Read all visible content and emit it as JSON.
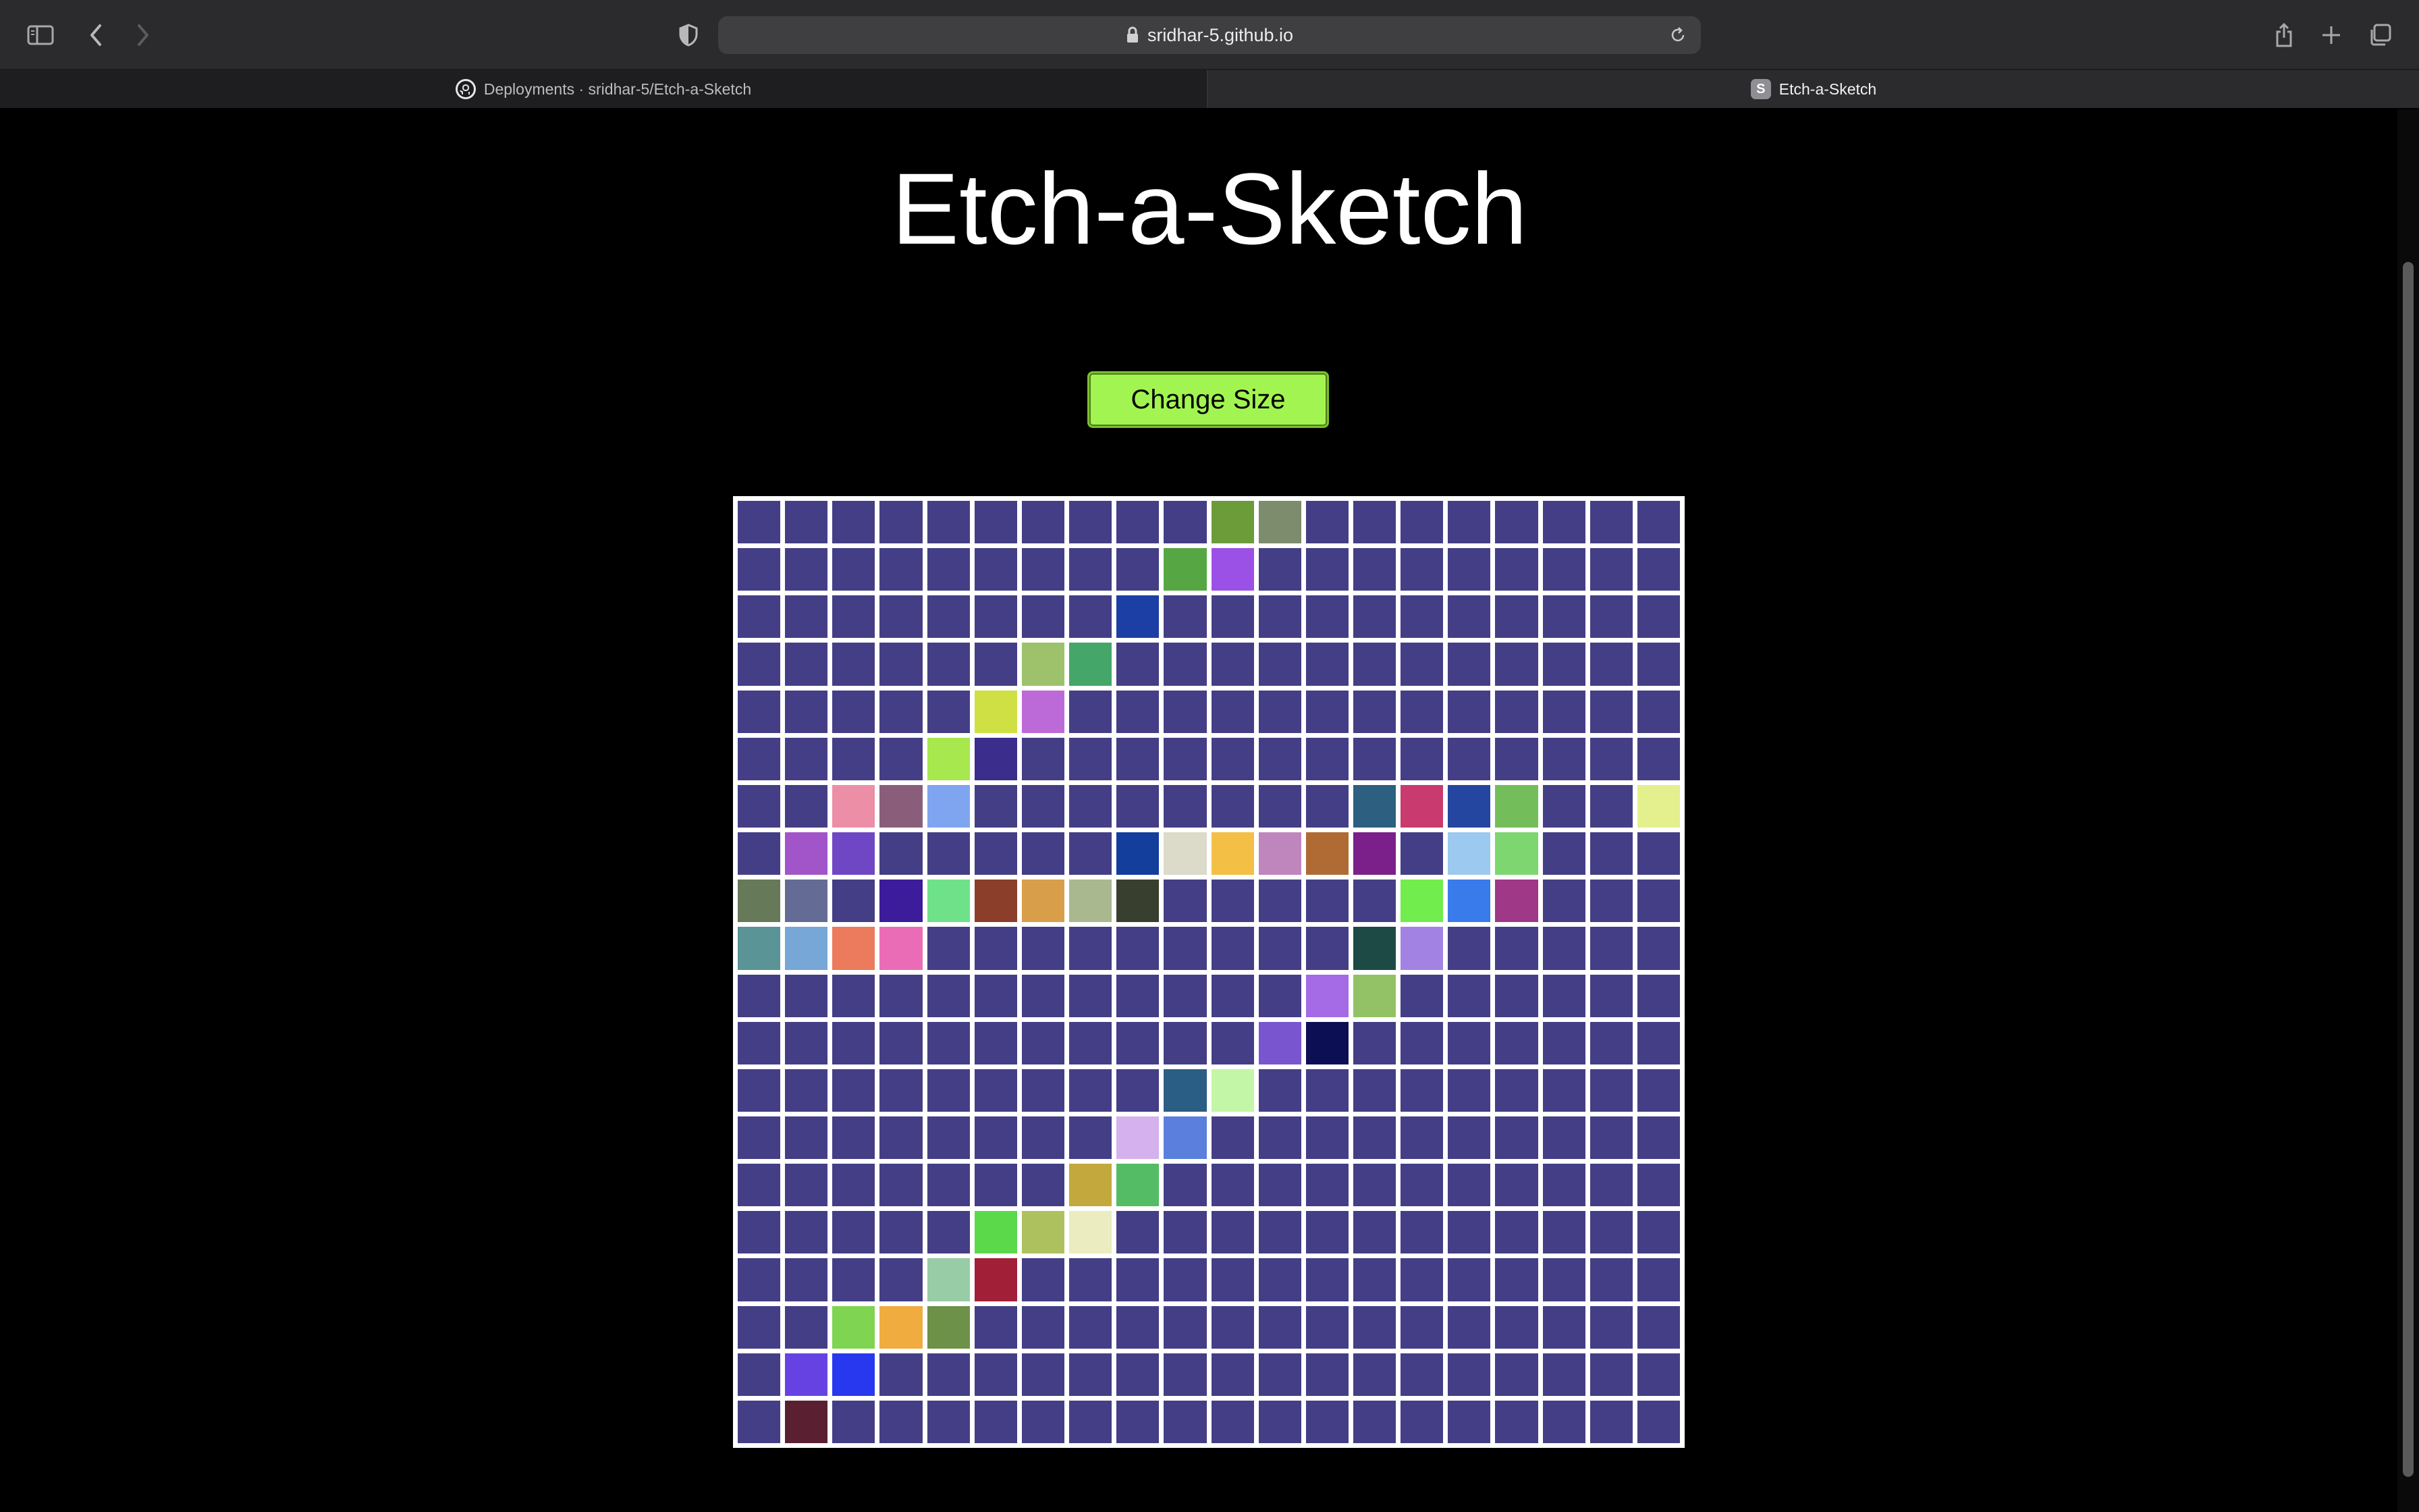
{
  "browser": {
    "url": "sridhar-5.github.io",
    "tabs": [
      {
        "label": "Deployments · sridhar-5/Etch-a-Sketch",
        "icon": "github-icon",
        "active": false
      },
      {
        "label": "Etch-a-Sketch",
        "icon": "S",
        "active": true
      }
    ]
  },
  "page": {
    "title": "Etch-a-Sketch",
    "change_size_label": "Change Size"
  },
  "grid": {
    "size": 20,
    "base_color": "#443e86",
    "colored_cells": [
      {
        "r": 0,
        "c": 10,
        "color": "#6c9b3a"
      },
      {
        "r": 0,
        "c": 11,
        "color": "#7d8c6c"
      },
      {
        "r": 1,
        "c": 9,
        "color": "#56a744"
      },
      {
        "r": 1,
        "c": 10,
        "color": "#9b50e6"
      },
      {
        "r": 2,
        "c": 8,
        "color": "#1b3fa5"
      },
      {
        "r": 3,
        "c": 6,
        "color": "#9dc26b"
      },
      {
        "r": 3,
        "c": 7,
        "color": "#45a66a"
      },
      {
        "r": 4,
        "c": 5,
        "color": "#cfe045"
      },
      {
        "r": 4,
        "c": 6,
        "color": "#bd6ad9"
      },
      {
        "r": 5,
        "c": 4,
        "color": "#a6e84d"
      },
      {
        "r": 5,
        "c": 5,
        "color": "#3a2d8b"
      },
      {
        "r": 6,
        "c": 2,
        "color": "#ec8fa6"
      },
      {
        "r": 6,
        "c": 3,
        "color": "#8a5e7a"
      },
      {
        "r": 6,
        "c": 4,
        "color": "#7fa4f0"
      },
      {
        "r": 6,
        "c": 13,
        "color": "#2c5f80"
      },
      {
        "r": 6,
        "c": 14,
        "color": "#c93a6e"
      },
      {
        "r": 6,
        "c": 15,
        "color": "#2446a0"
      },
      {
        "r": 6,
        "c": 16,
        "color": "#73be5a"
      },
      {
        "r": 6,
        "c": 19,
        "color": "#e4ef8e"
      },
      {
        "r": 7,
        "c": 1,
        "color": "#a254c9"
      },
      {
        "r": 7,
        "c": 2,
        "color": "#6f47c5"
      },
      {
        "r": 7,
        "c": 8,
        "color": "#143e9c"
      },
      {
        "r": 7,
        "c": 9,
        "color": "#dcdac8"
      },
      {
        "r": 7,
        "c": 10,
        "color": "#f3bf45"
      },
      {
        "r": 7,
        "c": 11,
        "color": "#be86bd"
      },
      {
        "r": 7,
        "c": 12,
        "color": "#b06a33"
      },
      {
        "r": 7,
        "c": 13,
        "color": "#7b1f8a"
      },
      {
        "r": 7,
        "c": 15,
        "color": "#9cc9ef"
      },
      {
        "r": 7,
        "c": 16,
        "color": "#7dd670"
      },
      {
        "r": 8,
        "c": 0,
        "color": "#667a5a"
      },
      {
        "r": 8,
        "c": 1,
        "color": "#646b94"
      },
      {
        "r": 8,
        "c": 3,
        "color": "#3c1c9a"
      },
      {
        "r": 8,
        "c": 4,
        "color": "#6fe189"
      },
      {
        "r": 8,
        "c": 5,
        "color": "#8b3e2a"
      },
      {
        "r": 8,
        "c": 6,
        "color": "#d99e4a"
      },
      {
        "r": 8,
        "c": 7,
        "color": "#a9b88f"
      },
      {
        "r": 8,
        "c": 8,
        "color": "#393f2e"
      },
      {
        "r": 8,
        "c": 14,
        "color": "#71ed4e"
      },
      {
        "r": 8,
        "c": 15,
        "color": "#3a7bec"
      },
      {
        "r": 8,
        "c": 16,
        "color": "#9e3887"
      },
      {
        "r": 9,
        "c": 0,
        "color": "#5a9496"
      },
      {
        "r": 9,
        "c": 1,
        "color": "#76a7d6"
      },
      {
        "r": 9,
        "c": 2,
        "color": "#ec7a5c"
      },
      {
        "r": 9,
        "c": 3,
        "color": "#eb6cb6"
      },
      {
        "r": 9,
        "c": 13,
        "color": "#1d4a45"
      },
      {
        "r": 9,
        "c": 14,
        "color": "#a283e4"
      },
      {
        "r": 10,
        "c": 12,
        "color": "#a56ae6"
      },
      {
        "r": 10,
        "c": 13,
        "color": "#93c266"
      },
      {
        "r": 11,
        "c": 11,
        "color": "#7956cf"
      },
      {
        "r": 11,
        "c": 12,
        "color": "#0d0f55"
      },
      {
        "r": 12,
        "c": 9,
        "color": "#2a5e84"
      },
      {
        "r": 12,
        "c": 10,
        "color": "#c3f6a6"
      },
      {
        "r": 13,
        "c": 8,
        "color": "#d5b1ee"
      },
      {
        "r": 13,
        "c": 9,
        "color": "#5a7fdc"
      },
      {
        "r": 14,
        "c": 7,
        "color": "#c3a93d"
      },
      {
        "r": 14,
        "c": 8,
        "color": "#54bc65"
      },
      {
        "r": 15,
        "c": 5,
        "color": "#5bd94b"
      },
      {
        "r": 15,
        "c": 6,
        "color": "#adc25e"
      },
      {
        "r": 15,
        "c": 7,
        "color": "#ebecbf"
      },
      {
        "r": 16,
        "c": 4,
        "color": "#98cca6"
      },
      {
        "r": 16,
        "c": 5,
        "color": "#a21f38"
      },
      {
        "r": 17,
        "c": 2,
        "color": "#7fd451"
      },
      {
        "r": 17,
        "c": 3,
        "color": "#f0ac3e"
      },
      {
        "r": 17,
        "c": 4,
        "color": "#6d9148"
      },
      {
        "r": 18,
        "c": 1,
        "color": "#6742e3"
      },
      {
        "r": 18,
        "c": 2,
        "color": "#2838ee"
      },
      {
        "r": 19,
        "c": 1,
        "color": "#5b1f32"
      }
    ]
  }
}
